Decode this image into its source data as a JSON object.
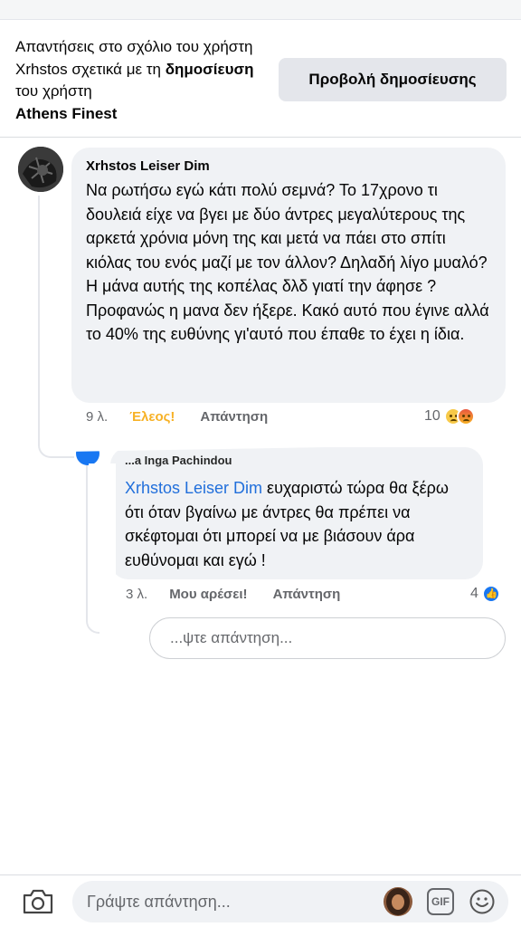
{
  "header": {
    "prefix": "Απαντήσεις στο σχόλιο του χρήστη ",
    "commenter": "Xrhstos",
    "middle": " σχετικά με τη ",
    "post_word": "δημοσίευση",
    "suffix": " του χρήστη ",
    "page_name": "Athens Finest",
    "view_post_label": "Προβολή δημοσίευσης"
  },
  "main_comment": {
    "author": "Xrhstos Leiser Dim",
    "text": "Να ρωτήσω εγώ κάτι πολύ σεμνά? Το 17χρονο τι δουλειά είχε να βγει με δύο άντρες μεγαλύτερους της αρκετά χρόνια μόνη της και μετά να πάει στο σπίτι κιόλας του ενός μαζί με τον άλλον? Δηλαδή λίγο μυαλό? Η μάνα αυτής της κοπέλας δλδ γιατί την άφησε ? Προφανώς η μανα δεν ήξερε. Κακό αυτό που έγινε αλλά το 40% της ευθύνης γι'αυτό που έπαθε το έχει η ίδια.",
    "time": "9 λ.",
    "reaction_label": "Έλεος!",
    "reply_label": "Απάντηση",
    "reaction_count": "10"
  },
  "reply_comment": {
    "author_partial": "...a Inga Pachindou",
    "mention": "Xrhstos Leiser Dim",
    "text": " ευχαριστώ τώρα θα ξέρω ότι όταν βγαίνω με άντρες θα πρέπει να σκέφτομαι ότι μπορεί να με βιάσουν άρα ευθύνομαι και εγώ !",
    "time": "3 λ.",
    "like_label": "Μου αρέσει!",
    "reply_label": "Απάντηση",
    "reaction_count": "4"
  },
  "inline_reply": {
    "placeholder": "...ψτε απάντηση..."
  },
  "bottom_bar": {
    "placeholder": "Γράψτε απάντηση...",
    "gif_label": "GIF"
  },
  "colors": {
    "mention": "#216fdb",
    "eleos": "#f7b125",
    "bubble": "#f0f2f5",
    "meta": "#65676b"
  }
}
